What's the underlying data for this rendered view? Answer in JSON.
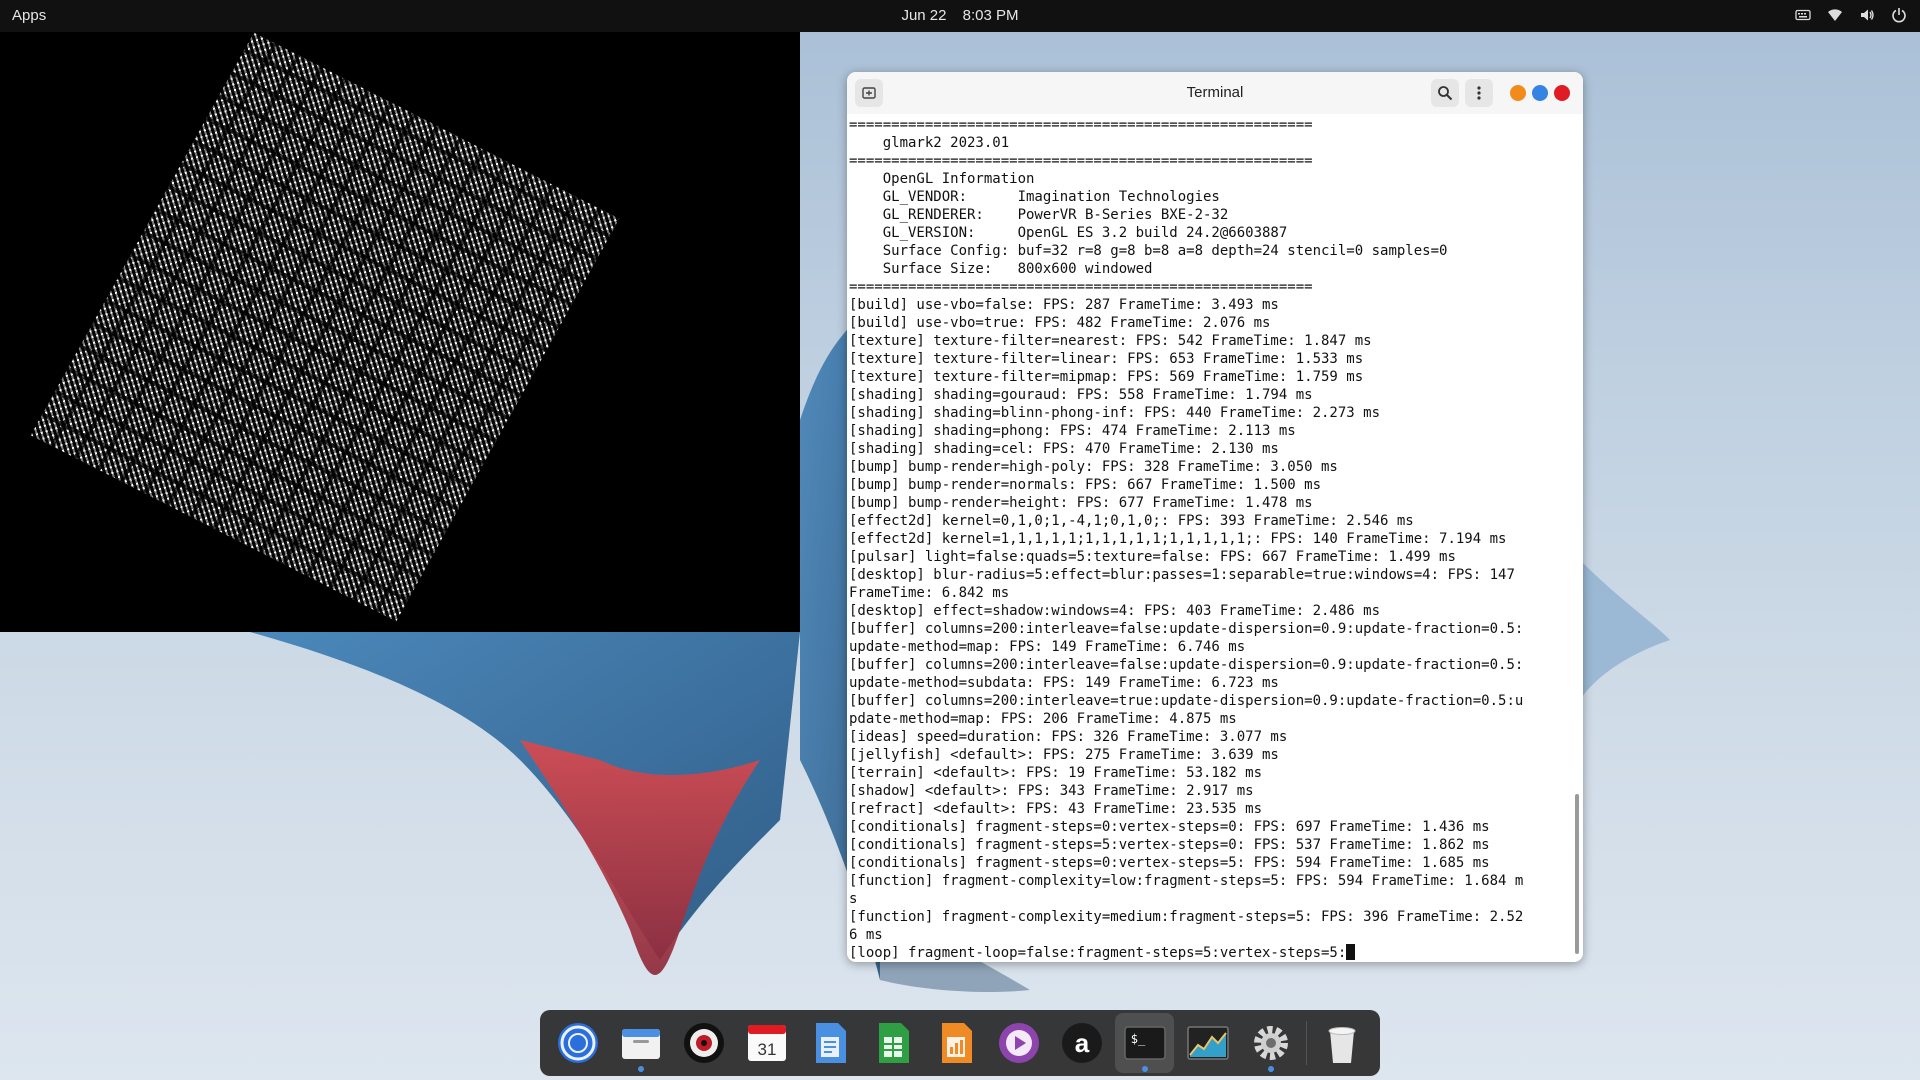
{
  "topbar": {
    "apps_label": "Apps",
    "date": "Jun 22",
    "time": "8:03 PM",
    "tray_icons": [
      "keyboard-icon",
      "wifi-icon",
      "volume-icon",
      "power-icon"
    ]
  },
  "terminal": {
    "title": "Terminal",
    "lines": [
      "=======================================================",
      "    glmark2 2023.01",
      "=======================================================",
      "    OpenGL Information",
      "    GL_VENDOR:      Imagination Technologies",
      "    GL_RENDERER:    PowerVR B-Series BXE-2-32",
      "    GL_VERSION:     OpenGL ES 3.2 build 24.2@6603887",
      "    Surface Config: buf=32 r=8 g=8 b=8 a=8 depth=24 stencil=0 samples=0",
      "    Surface Size:   800x600 windowed",
      "=======================================================",
      "[build] use-vbo=false: FPS: 287 FrameTime: 3.493 ms",
      "[build] use-vbo=true: FPS: 482 FrameTime: 2.076 ms",
      "[texture] texture-filter=nearest: FPS: 542 FrameTime: 1.847 ms",
      "[texture] texture-filter=linear: FPS: 653 FrameTime: 1.533 ms",
      "[texture] texture-filter=mipmap: FPS: 569 FrameTime: 1.759 ms",
      "[shading] shading=gouraud: FPS: 558 FrameTime: 1.794 ms",
      "[shading] shading=blinn-phong-inf: FPS: 440 FrameTime: 2.273 ms",
      "[shading] shading=phong: FPS: 474 FrameTime: 2.113 ms",
      "[shading] shading=cel: FPS: 470 FrameTime: 2.130 ms",
      "[bump] bump-render=high-poly: FPS: 328 FrameTime: 3.050 ms",
      "[bump] bump-render=normals: FPS: 667 FrameTime: 1.500 ms",
      "[bump] bump-render=height: FPS: 677 FrameTime: 1.478 ms",
      "[effect2d] kernel=0,1,0;1,-4,1;0,1,0;: FPS: 393 FrameTime: 2.546 ms",
      "[effect2d] kernel=1,1,1,1,1;1,1,1,1,1;1,1,1,1,1;: FPS: 140 FrameTime: 7.194 ms",
      "[pulsar] light=false:quads=5:texture=false: FPS: 667 FrameTime: 1.499 ms",
      "[desktop] blur-radius=5:effect=blur:passes=1:separable=true:windows=4: FPS: 147",
      "FrameTime: 6.842 ms",
      "[desktop] effect=shadow:windows=4: FPS: 403 FrameTime: 2.486 ms",
      "[buffer] columns=200:interleave=false:update-dispersion=0.9:update-fraction=0.5:",
      "update-method=map: FPS: 149 FrameTime: 6.746 ms",
      "[buffer] columns=200:interleave=false:update-dispersion=0.9:update-fraction=0.5:",
      "update-method=subdata: FPS: 149 FrameTime: 6.723 ms",
      "[buffer] columns=200:interleave=true:update-dispersion=0.9:update-fraction=0.5:u",
      "pdate-method=map: FPS: 206 FrameTime: 4.875 ms",
      "[ideas] speed=duration: FPS: 326 FrameTime: 3.077 ms",
      "[jellyfish] <default>: FPS: 275 FrameTime: 3.639 ms",
      "[terrain] <default>: FPS: 19 FrameTime: 53.182 ms",
      "[shadow] <default>: FPS: 343 FrameTime: 2.917 ms",
      "[refract] <default>: FPS: 43 FrameTime: 23.535 ms",
      "[conditionals] fragment-steps=0:vertex-steps=0: FPS: 697 FrameTime: 1.436 ms",
      "[conditionals] fragment-steps=5:vertex-steps=0: FPS: 537 FrameTime: 1.862 ms",
      "[conditionals] fragment-steps=0:vertex-steps=5: FPS: 594 FrameTime: 1.685 ms",
      "[function] fragment-complexity=low:fragment-steps=5: FPS: 594 FrameTime: 1.684 m",
      "s",
      "[function] fragment-complexity=medium:fragment-steps=5: FPS: 396 FrameTime: 2.52",
      "6 ms",
      "[loop] fragment-loop=false:fragment-steps=5:vertex-steps=5:"
    ]
  },
  "dock": {
    "items": [
      {
        "name": "chromium-icon",
        "running": false
      },
      {
        "name": "files-icon",
        "running": true
      },
      {
        "name": "media-player-icon",
        "running": false
      },
      {
        "name": "calendar-icon",
        "running": false,
        "label": "31"
      },
      {
        "name": "writer-icon",
        "running": false
      },
      {
        "name": "calc-icon",
        "running": false
      },
      {
        "name": "impress-icon",
        "running": false
      },
      {
        "name": "video-player-icon",
        "running": false
      },
      {
        "name": "app-store-icon",
        "running": false,
        "label": "a"
      },
      {
        "name": "terminal-icon",
        "running": true,
        "label": "$_"
      },
      {
        "name": "system-monitor-icon",
        "running": false
      },
      {
        "name": "settings-icon",
        "running": true
      },
      {
        "name": "trash-icon",
        "running": false
      }
    ]
  }
}
